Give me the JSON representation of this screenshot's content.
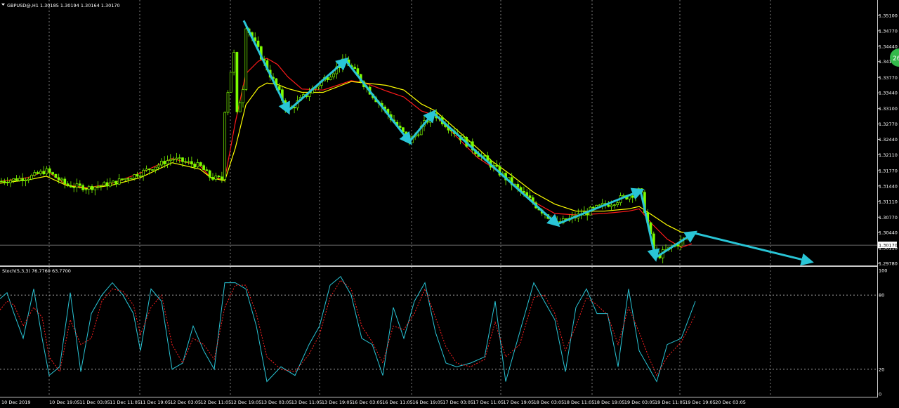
{
  "chart_data": [
    {
      "type": "candlestick",
      "title": "GBPUSD@,H1  1.30185 1.30194 1.30164 1.30170",
      "timeframe": "H1",
      "symbol": "GBPUSD@",
      "ylim": [
        1.2978,
        1.3526
      ],
      "y_ticks": [
        "1.35100",
        "1.34770",
        "1.34440",
        "1.34110",
        "1.33770",
        "1.33440",
        "1.33100",
        "1.32770",
        "1.32440",
        "1.32110",
        "1.31770",
        "1.31440",
        "1.31110",
        "1.30770",
        "1.30440",
        "1.30110",
        "1.29780"
      ],
      "x_ticks": [
        "10 Dec 2019",
        "10 Dec 19:05",
        "11 Dec 03:05",
        "11 Dec 11:05",
        "11 Dec 19:05",
        "12 Dec 03:05",
        "12 Dec 11:05",
        "12 Dec 19:05",
        "13 Dec 03:05",
        "13 Dec 11:05",
        "13 Dec 19:05",
        "16 Dec 03:05",
        "16 Dec 11:05",
        "16 Dec 19:05",
        "17 Dec 03:05",
        "17 Dec 11:05",
        "17 Dec 19:05",
        "18 Dec 03:05",
        "18 Dec 11:05",
        "18 Dec 19:05",
        "19 Dec 03:05",
        "19 Dec 11:05",
        "19 Dec 19:05",
        "20 Dec 03:05"
      ],
      "current_price": "1.30170",
      "grid": true,
      "candle_color": "#7cfc00",
      "overlays": [
        {
          "name": "ma-red",
          "color": "#ff1a1a",
          "x": [
            0,
            40,
            66,
            95,
            125,
            160,
            200,
            245,
            285,
            300,
            320,
            335,
            350,
            368,
            380,
            395,
            410,
            430,
            460,
            500,
            520,
            550,
            575,
            600,
            620,
            650,
            680,
            700,
            730,
            760,
            790,
            820,
            860,
            895,
            910,
            930,
            950,
            970,
            985
          ],
          "y": [
            1.3154,
            1.3162,
            1.3177,
            1.3146,
            1.314,
            1.315,
            1.3172,
            1.3203,
            1.3187,
            1.3162,
            1.3158,
            1.328,
            1.3385,
            1.3412,
            1.3418,
            1.3405,
            1.3378,
            1.3352,
            1.335,
            1.337,
            1.3365,
            1.3348,
            1.3335,
            1.3305,
            1.3295,
            1.325,
            1.3205,
            1.3185,
            1.315,
            1.311,
            1.3085,
            1.3082,
            1.3085,
            1.309,
            1.3095,
            1.306,
            1.303,
            1.3012,
            1.302
          ]
        },
        {
          "name": "ma-yellow",
          "color": "#ffff00",
          "x": [
            0,
            40,
            66,
            95,
            125,
            160,
            200,
            245,
            285,
            300,
            320,
            335,
            350,
            368,
            380,
            395,
            410,
            430,
            460,
            500,
            520,
            550,
            575,
            600,
            620,
            650,
            680,
            700,
            730,
            760,
            790,
            820,
            860,
            895,
            910,
            930,
            950,
            970,
            985
          ],
          "y": [
            1.315,
            1.3157,
            1.3165,
            1.3145,
            1.3138,
            1.3146,
            1.3162,
            1.3194,
            1.318,
            1.3162,
            1.3155,
            1.3225,
            1.3318,
            1.3355,
            1.3365,
            1.3362,
            1.3353,
            1.3345,
            1.3345,
            1.3368,
            1.3365,
            1.336,
            1.335,
            1.332,
            1.3305,
            1.3265,
            1.3225,
            1.3198,
            1.3165,
            1.313,
            1.3105,
            1.309,
            1.309,
            1.3095,
            1.31,
            1.308,
            1.306,
            1.3045,
            1.3042
          ]
        }
      ],
      "zigzag": {
        "color": "#29c5d6",
        "x": [
          347,
          410,
          492,
          583,
          617,
          793,
          912,
          933,
          988,
          1153
        ],
        "y": [
          1.3499,
          1.3305,
          1.3414,
          1.3239,
          1.3301,
          1.3062,
          1.3134,
          1.299,
          1.3043,
          1.2982
        ]
      }
    },
    {
      "type": "line",
      "title": "Stoch(5,3,3) 76.7760 63.7700",
      "ylim": [
        0,
        100
      ],
      "y_ticks": [
        "100",
        "80",
        "20",
        "0"
      ],
      "levels": [
        80,
        20
      ],
      "series": [
        {
          "name": "main",
          "color": "#29c5d6",
          "x": [
            0,
            10,
            20,
            33,
            48,
            60,
            70,
            85,
            100,
            115,
            130,
            145,
            160,
            175,
            190,
            200,
            215,
            230,
            245,
            260,
            275,
            290,
            305,
            320,
            335,
            350,
            365,
            380,
            400,
            420,
            440,
            455,
            470,
            485,
            500,
            515,
            530,
            545,
            560,
            575,
            590,
            605,
            620,
            635,
            650,
            670,
            690,
            705,
            720,
            740,
            760,
            775,
            790,
            805,
            820,
            835,
            850,
            865,
            880,
            895,
            910,
            925,
            935,
            950,
            970,
            990
          ],
          "y": [
            77,
            82,
            65,
            45,
            85,
            45,
            15,
            22,
            82,
            18,
            65,
            80,
            90,
            80,
            65,
            35,
            85,
            75,
            20,
            25,
            55,
            35,
            20,
            90,
            90,
            85,
            55,
            10,
            22,
            15,
            40,
            55,
            88,
            95,
            80,
            45,
            40,
            15,
            70,
            45,
            75,
            90,
            50,
            25,
            22,
            25,
            30,
            75,
            10,
            50,
            90,
            75,
            60,
            18,
            70,
            85,
            65,
            65,
            22,
            85,
            35,
            20,
            10,
            40,
            45,
            75
          ]
        },
        {
          "name": "signal",
          "color": "#ff2020",
          "x": [
            0,
            10,
            20,
            33,
            48,
            60,
            70,
            85,
            100,
            115,
            130,
            145,
            160,
            175,
            190,
            200,
            215,
            230,
            245,
            260,
            275,
            290,
            305,
            320,
            335,
            350,
            365,
            380,
            400,
            420,
            440,
            455,
            470,
            485,
            500,
            515,
            530,
            545,
            560,
            575,
            590,
            605,
            620,
            635,
            650,
            670,
            690,
            705,
            720,
            740,
            760,
            775,
            790,
            805,
            820,
            835,
            850,
            865,
            880,
            895,
            910,
            925,
            935,
            950,
            970,
            990
          ],
          "y": [
            68,
            75,
            72,
            55,
            70,
            62,
            30,
            18,
            60,
            40,
            45,
            75,
            85,
            83,
            72,
            48,
            70,
            80,
            40,
            25,
            45,
            40,
            28,
            70,
            88,
            88,
            65,
            30,
            20,
            18,
            32,
            48,
            78,
            92,
            85,
            55,
            42,
            25,
            55,
            52,
            65,
            85,
            62,
            38,
            25,
            22,
            28,
            58,
            30,
            40,
            78,
            80,
            65,
            35,
            55,
            78,
            72,
            64,
            40,
            70,
            50,
            28,
            15,
            30,
            42,
            64
          ]
        }
      ]
    }
  ],
  "badge": {
    "text": "26",
    "color": "#33b84a"
  }
}
